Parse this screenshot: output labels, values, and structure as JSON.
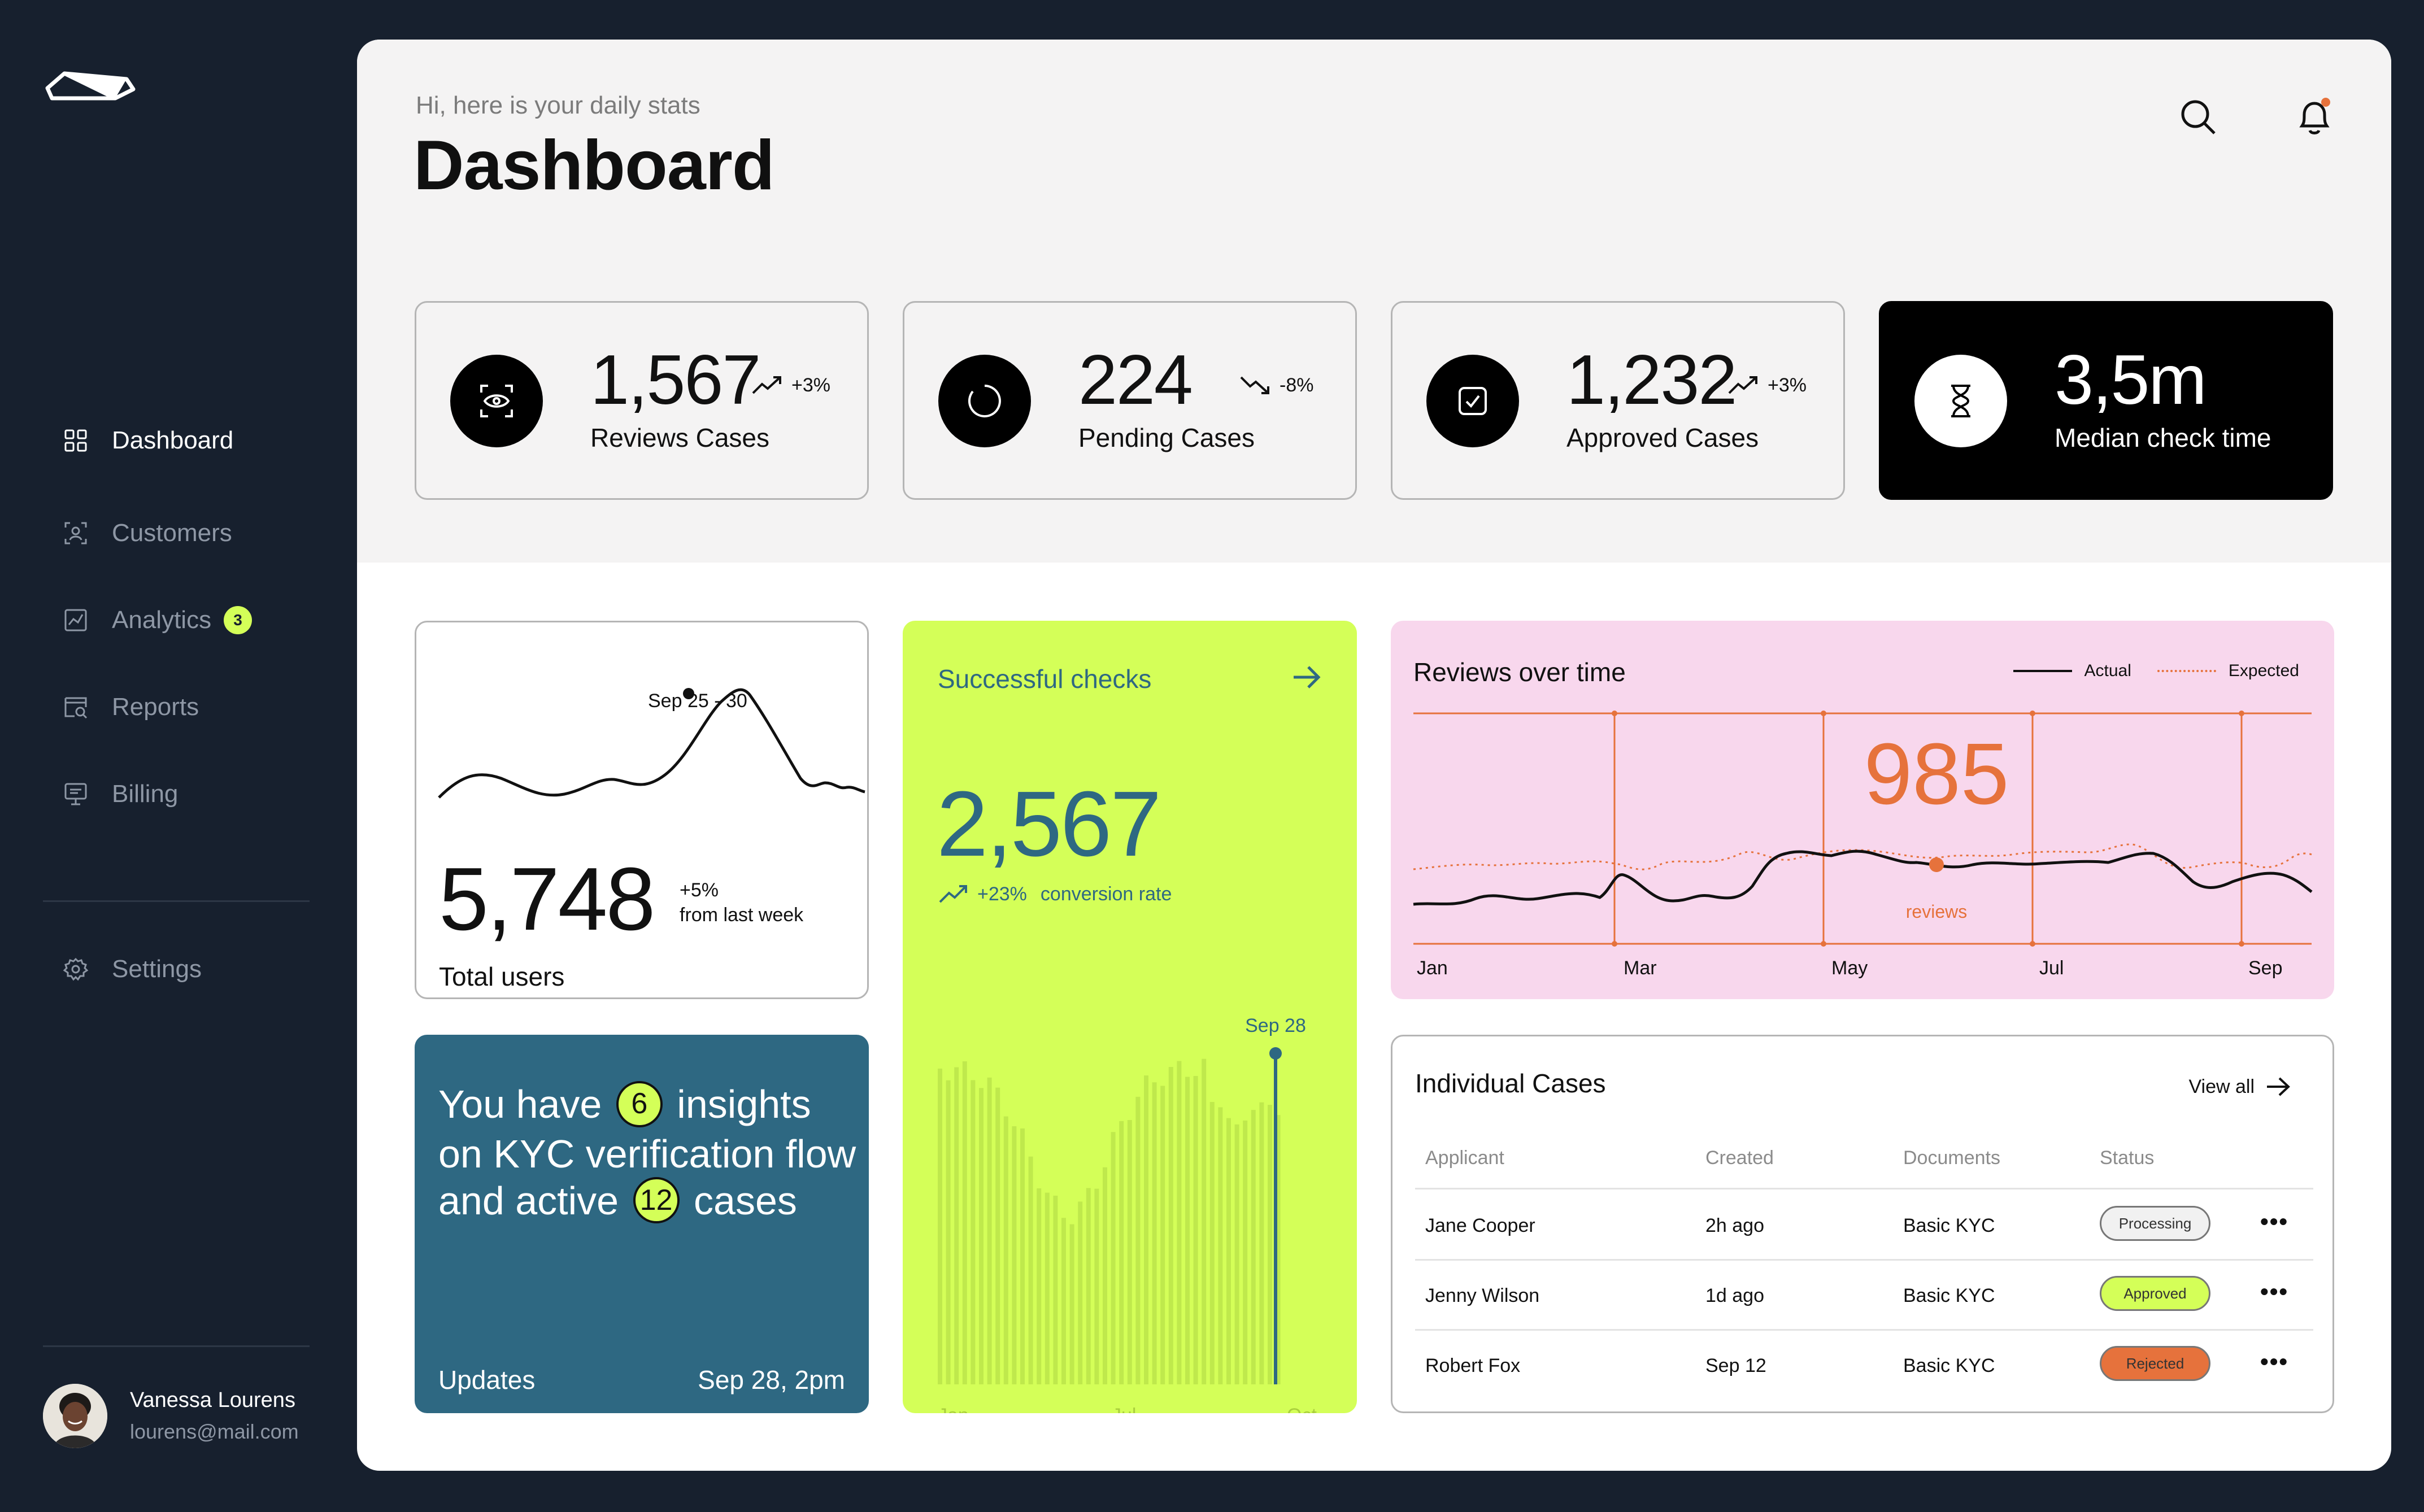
{
  "sidebar": {
    "nav": [
      {
        "label": "Dashboard",
        "icon": "grid-icon"
      },
      {
        "label": "Customers",
        "icon": "face-scan-icon"
      },
      {
        "label": "Analytics",
        "icon": "chart-icon",
        "badge": "3"
      },
      {
        "label": "Reports",
        "icon": "report-search-icon"
      },
      {
        "label": "Billing",
        "icon": "monitor-icon"
      }
    ],
    "settings": "Settings",
    "user": {
      "name": "Vanessa Lourens",
      "email": "lourens@mail.com"
    }
  },
  "header": {
    "subtitle": "Hi, here is your daily stats",
    "title": "Dashboard"
  },
  "stats": [
    {
      "value": "1,567",
      "label": "Reviews Cases",
      "change": "+3%",
      "trend": "up",
      "icon": "eye-scan-icon"
    },
    {
      "value": "224",
      "label": "Pending Cases",
      "change": "-8%",
      "trend": "down",
      "icon": "loading-icon"
    },
    {
      "value": "1,232",
      "label": "Approved Cases",
      "change": "+3%",
      "trend": "up",
      "icon": "check-icon"
    },
    {
      "value": "3,5m",
      "label": "Median check time",
      "icon": "hourglass-icon"
    }
  ],
  "users_card": {
    "value": "5,748",
    "change": "+5%",
    "change_note": "from last week",
    "label": "Total users",
    "tooltip": "Sep 25 - 30"
  },
  "insight_card": {
    "text_1": "You have",
    "count_1": "6",
    "text_2": "insights on KYC verification flow and active",
    "count_2": "12",
    "text_3": "cases",
    "footer_left": "Updates",
    "footer_right": "Sep 28, 2pm"
  },
  "checks_card": {
    "title": "Successful checks",
    "value": "2,567",
    "change": "+23%",
    "change_note": "conversion rate",
    "tooltip": "Sep 28",
    "axis": [
      "Jan",
      "Jul",
      "Oct"
    ]
  },
  "reviews_card": {
    "title": "Reviews over time",
    "legend_actual": "Actual",
    "legend_expected": "Expected",
    "highlight_value": "985",
    "highlight_label": "reviews",
    "axis": [
      "Jan",
      "Mar",
      "May",
      "Jul",
      "Sep"
    ]
  },
  "cases_card": {
    "title": "Individual Cases",
    "view_all": "View all",
    "headers": [
      "Applicant",
      "Created",
      "Documents",
      "Status"
    ],
    "rows": [
      {
        "applicant": "Jane Cooper",
        "created": "2h ago",
        "documents": "Basic KYC",
        "status": "Processing"
      },
      {
        "applicant": "Jenny Wilson",
        "created": "1d ago",
        "documents": "Basic KYC",
        "status": "Approved"
      },
      {
        "applicant": "Robert Fox",
        "created": "Sep 12",
        "documents": "Basic KYC",
        "status": "Rejected"
      }
    ]
  },
  "colors": {
    "sidebar_bg": "#17202e",
    "accent_lime": "#d4ff58",
    "accent_teal": "#2e6882",
    "accent_pink": "#f8d7ed",
    "accent_orange": "#e6723c"
  }
}
